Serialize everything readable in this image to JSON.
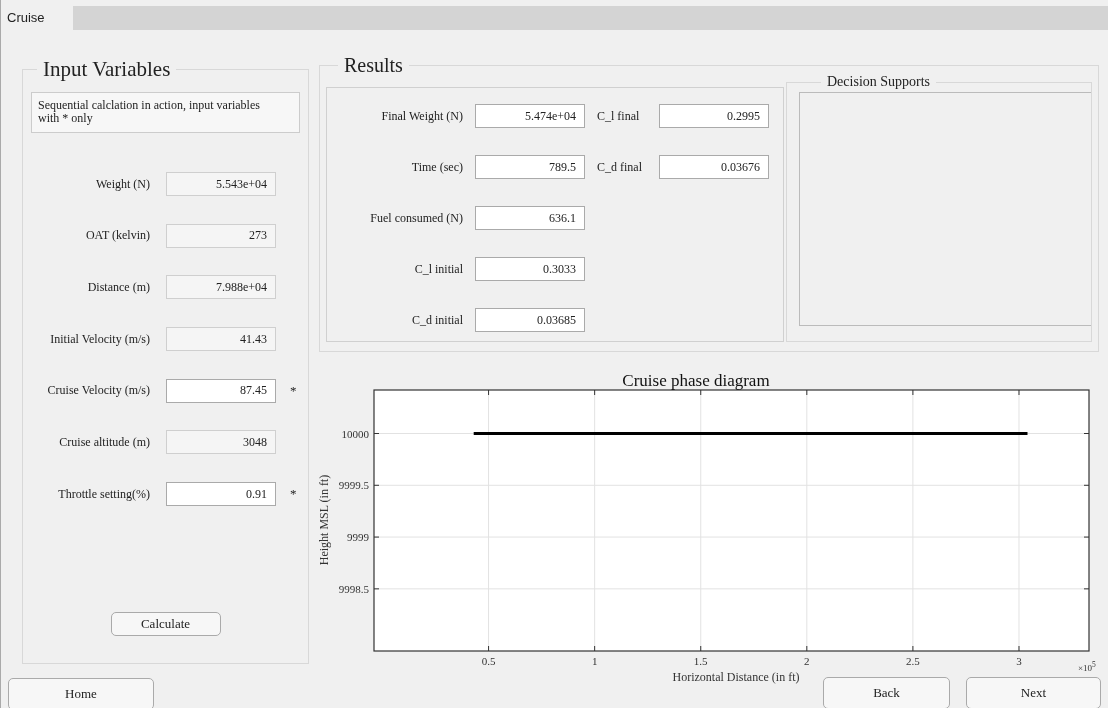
{
  "tabs": [
    {
      "label": "Cruise",
      "selected": true
    }
  ],
  "input_panel": {
    "title": "Input Variables",
    "note": "Sequential calclation in action, input variables with * only",
    "fields": [
      {
        "label": "Weight (N)",
        "value": "5.543e+04",
        "editable": false
      },
      {
        "label": "OAT (kelvin)",
        "value": "273",
        "editable": false
      },
      {
        "label": "Distance (m)",
        "value": "7.988e+04",
        "editable": false
      },
      {
        "label": "Initial Velocity (m/s)",
        "value": "41.43",
        "editable": false
      },
      {
        "label": "Cruise Velocity (m/s)",
        "value": "87.45",
        "editable": true,
        "marker": "*"
      },
      {
        "label": "Cruise altitude (m)",
        "value": "3048",
        "editable": false
      },
      {
        "label": "Throttle setting(%)",
        "value": "0.91",
        "editable": true,
        "marker": "*"
      }
    ],
    "button": "Calculate"
  },
  "results": {
    "title": "Results",
    "columns": [
      [
        {
          "label": "Final Weight (N)",
          "value": "5.474e+04"
        },
        {
          "label": "Time (sec)",
          "value": "789.5"
        },
        {
          "label": "Fuel consumed (N)",
          "value": "636.1"
        },
        {
          "label": "C_l initial",
          "value": "0.3033"
        },
        {
          "label": "C_d initial",
          "value": "0.03685"
        }
      ],
      [
        {
          "label": "C_l final",
          "value": "0.2995"
        },
        {
          "label": "C_d final",
          "value": "0.03676"
        }
      ]
    ]
  },
  "decision_supports": {
    "title": "Decision Supports"
  },
  "chart": {
    "chart_data": {
      "type": "line",
      "title": "Cruise phase diagram",
      "xlabel": "Horizontal Distance (in ft)",
      "ylabel": "Height MSL (in ft)",
      "x": [
        0.43,
        3.04
      ],
      "series": [
        {
          "color": "#000000",
          "values": [
            10000,
            10000
          ]
        }
      ],
      "xlim": [
        -0.04,
        3.33
      ],
      "ylim": [
        9997.9,
        10000.42
      ],
      "xticks": [
        0.5,
        1,
        1.5,
        2,
        2.5,
        3
      ],
      "grid": true,
      "yticks": [
        {
          "value": 9998.5,
          "label": "9998.5"
        },
        {
          "value": 9999,
          "label": "9999"
        },
        {
          "value": 9999.5,
          "label": "9999.5"
        },
        {
          "value": 10000,
          "label": "10000"
        }
      ],
      "annotations": [
        "×10$^{5}$"
      ]
    }
  },
  "buttons": {
    "home": "Home",
    "back": "Back",
    "next": "Next"
  }
}
